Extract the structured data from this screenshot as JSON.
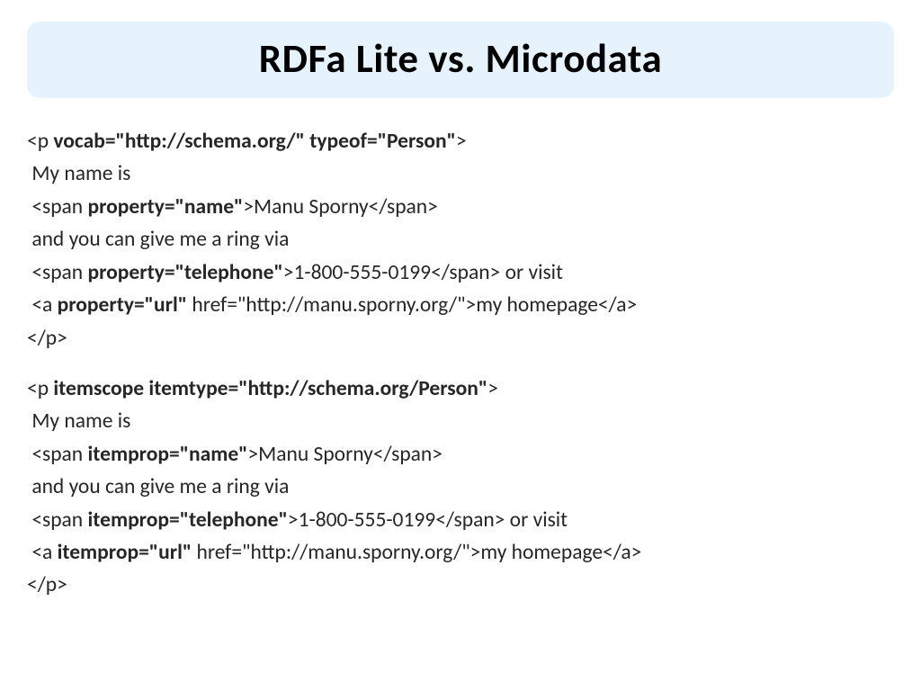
{
  "title": "RDFa Lite vs. Microdata",
  "rdfa": {
    "l1_a": "<p ",
    "l1_b": "vocab=\"http://schema.org/\" typeof=\"Person\"",
    "l1_c": ">",
    "l2": " My name is",
    "l3_a": " <span ",
    "l3_b": "property=\"name\"",
    "l3_c": ">Manu Sporny</span>",
    "l4": " and you can give me a ring via",
    "l5_a": " <span ",
    "l5_b": "property=\"telephone\"",
    "l5_c": ">1-800-555-0199</span> or visit",
    "l6_a": " <a ",
    "l6_b": "property=\"url\"",
    "l6_c": " href=\"http://manu.sporny.org/\">my homepage</a>",
    "l7": "</p>"
  },
  "micro": {
    "l1_a": "<p ",
    "l1_b": "itemscope itemtype=\"http://schema.org/Person\"",
    "l1_c": ">",
    "l2": " My name is",
    "l3_a": " <span ",
    "l3_b": "itemprop=\"name\"",
    "l3_c": ">Manu Sporny</span>",
    "l4": " and you can give me a ring via",
    "l5_a": " <span ",
    "l5_b": "itemprop=\"telephone\"",
    "l5_c": ">1-800-555-0199</span> or visit",
    "l6_a": " <a ",
    "l6_b": "itemprop=\"url\"",
    "l6_c": " href=\"http://manu.sporny.org/\">my homepage</a>",
    "l7": "</p>"
  }
}
